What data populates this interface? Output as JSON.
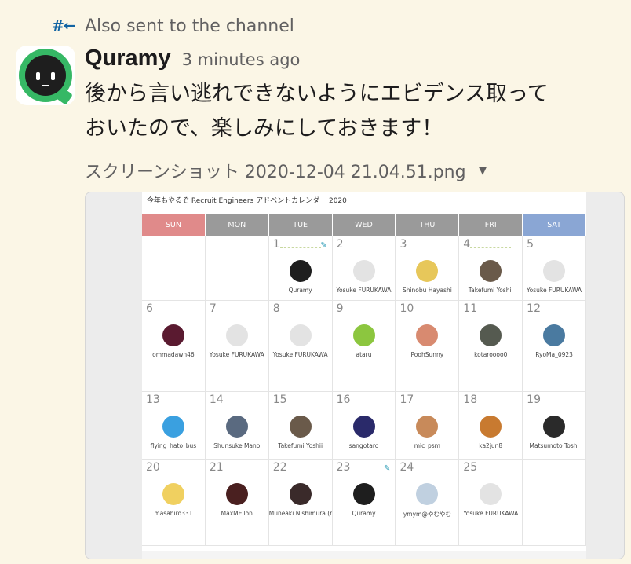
{
  "thread_note": {
    "icon": "#←",
    "text": "Also sent to the channel"
  },
  "message": {
    "sender": "Quramy",
    "timestamp": "3 minutes ago",
    "line1": "後から言い逃れできないようにエビデンス取って",
    "line2": "おいたので、楽しみにしておきます！"
  },
  "file": {
    "name": "スクリーンショット 2020-12-04 21.04.51.png",
    "caret": "▼"
  },
  "calendar": {
    "title": "今年もやるぞ Recruit Engineers アドベントカレンダー 2020",
    "days": [
      "SUN",
      "MON",
      "TUE",
      "WED",
      "THU",
      "FRI",
      "SAT"
    ],
    "cells": [
      {
        "num": "",
        "name": ""
      },
      {
        "num": "",
        "name": ""
      },
      {
        "num": "1",
        "name": "Quramy",
        "color": "#1e1e1e",
        "edit": true
      },
      {
        "num": "2",
        "name": "Yosuke FURUKAWA",
        "color": "#e3e3e3"
      },
      {
        "num": "3",
        "name": "Shinobu Hayashi",
        "color": "#e7c75a"
      },
      {
        "num": "4",
        "name": "Takefumi Yoshii",
        "color": "#6a5a4a"
      },
      {
        "num": "5",
        "name": "Yosuke FURUKAWA",
        "color": "#e3e3e3"
      },
      {
        "num": "6",
        "name": "ommadawn46",
        "color": "#5a1a30"
      },
      {
        "num": "7",
        "name": "Yosuke FURUKAWA",
        "color": "#e3e3e3"
      },
      {
        "num": "8",
        "name": "Yosuke FURUKAWA",
        "color": "#e3e3e3"
      },
      {
        "num": "9",
        "name": "ataru",
        "color": "#8cc63f"
      },
      {
        "num": "10",
        "name": "PoohSunny",
        "color": "#d88a70"
      },
      {
        "num": "11",
        "name": "kotaroooo0",
        "color": "#555a50"
      },
      {
        "num": "12",
        "name": "RyoMa_0923",
        "color": "#4a7aa0"
      },
      {
        "num": "13",
        "name": "flying_hato_bus",
        "color": "#3aa0e0"
      },
      {
        "num": "14",
        "name": "Shunsuke Mano",
        "color": "#5a6a80"
      },
      {
        "num": "15",
        "name": "Takefumi Yoshii",
        "color": "#6a5a4a"
      },
      {
        "num": "16",
        "name": "sangotaro",
        "color": "#2a2a6a"
      },
      {
        "num": "17",
        "name": "mic_psm",
        "color": "#c88a5a"
      },
      {
        "num": "18",
        "name": "ka2jun8",
        "color": "#c87a30"
      },
      {
        "num": "19",
        "name": "Matsumoto Toshi",
        "color": "#2a2a2a"
      },
      {
        "num": "20",
        "name": "masahiro331",
        "color": "#f0d060"
      },
      {
        "num": "21",
        "name": "MaxMEllon",
        "color": "#4a2020"
      },
      {
        "num": "22",
        "name": "Muneaki Nishimura (nishimunea)",
        "color": "#3a2a2a"
      },
      {
        "num": "23",
        "name": "Quramy",
        "color": "#1e1e1e",
        "edit": true
      },
      {
        "num": "24",
        "name": "ymym@やむやむ",
        "color": "#c0d0e0"
      },
      {
        "num": "25",
        "name": "Yosuke FURUKAWA",
        "color": "#e3e3e3"
      },
      {
        "num": "",
        "name": ""
      }
    ]
  }
}
